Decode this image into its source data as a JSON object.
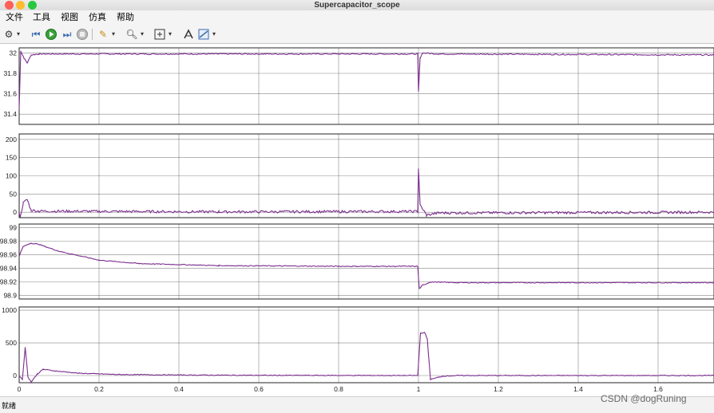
{
  "window": {
    "title": "Supercapacitor_scope"
  },
  "menu": {
    "items": [
      "文件",
      "工具",
      "视图",
      "仿真",
      "帮助"
    ]
  },
  "toolbar": {
    "icons": [
      "gear-icon",
      "rewind-icon",
      "run-icon",
      "step-forward-icon",
      "stop-icon",
      "highlight-icon",
      "zoom-icon",
      "fit-icon",
      "cursor-measure-icon",
      "signal-style-icon"
    ]
  },
  "colors": {
    "signal": "#7b2d8e",
    "grid": "#262626",
    "background": "#ffffff"
  },
  "chart_data": [
    {
      "type": "line",
      "ylim": [
        31.3,
        32.05
      ],
      "yticks": [
        "32",
        "31.8",
        "31.6",
        "31.4"
      ],
      "ytick_values": [
        32,
        31.8,
        31.6,
        31.4
      ],
      "xlim": [
        0,
        1.74
      ],
      "series": [
        {
          "values": [
            [
              0,
              31.45
            ],
            [
              0.004,
              32.02
            ],
            [
              0.012,
              31.95
            ],
            [
              0.02,
              31.9
            ],
            [
              0.03,
              31.98
            ],
            [
              0.05,
              31.99
            ],
            [
              0.5,
              31.99
            ],
            [
              0.998,
              31.99
            ],
            [
              1.0,
              31.62
            ],
            [
              1.004,
              31.95
            ],
            [
              1.01,
              32.0
            ],
            [
              1.05,
              31.99
            ],
            [
              1.74,
              31.98
            ]
          ]
        }
      ]
    },
    {
      "type": "line",
      "ylim": [
        -15,
        215
      ],
      "yticks": [
        "200",
        "150",
        "100",
        "50",
        "0"
      ],
      "ytick_values": [
        200,
        150,
        100,
        50,
        0
      ],
      "xlim": [
        0,
        1.74
      ],
      "series": [
        {
          "values": [
            [
              0,
              0
            ],
            [
              0.003,
              -12
            ],
            [
              0.01,
              25
            ],
            [
              0.02,
              35
            ],
            [
              0.03,
              5
            ],
            [
              0.05,
              3
            ],
            [
              0.5,
              1
            ],
            [
              0.998,
              2
            ],
            [
              1.0,
              120
            ],
            [
              1.004,
              20
            ],
            [
              1.02,
              -8
            ],
            [
              1.05,
              -2
            ],
            [
              1.74,
              0
            ]
          ]
        }
      ]
    },
    {
      "type": "line",
      "ylim": [
        98.895,
        99.005
      ],
      "yticks": [
        "99",
        "98.98",
        "98.96",
        "98.94",
        "98.92",
        "98.9"
      ],
      "ytick_values": [
        99,
        98.98,
        98.96,
        98.94,
        98.92,
        98.9
      ],
      "xlim": [
        0,
        1.74
      ],
      "series": [
        {
          "values": [
            [
              0,
              98.958
            ],
            [
              0.01,
              98.972
            ],
            [
              0.03,
              98.977
            ],
            [
              0.05,
              98.975
            ],
            [
              0.1,
              98.965
            ],
            [
              0.2,
              98.952
            ],
            [
              0.3,
              98.947
            ],
            [
              0.5,
              98.944
            ],
            [
              0.8,
              98.943
            ],
            [
              0.998,
              98.943
            ],
            [
              1.002,
              98.91
            ],
            [
              1.01,
              98.915
            ],
            [
              1.03,
              98.92
            ],
            [
              1.1,
              98.919
            ],
            [
              1.74,
              98.919
            ]
          ]
        }
      ]
    },
    {
      "type": "line",
      "ylim": [
        -110,
        1050
      ],
      "yticks": [
        "1000",
        "500",
        "0"
      ],
      "ytick_values": [
        1000,
        500,
        0
      ],
      "xlim": [
        0,
        1.74
      ],
      "xticks": [
        "0",
        "0.2",
        "0.4",
        "0.6",
        "0.8",
        "1",
        "1.2",
        "1.4",
        "1.6"
      ],
      "xtick_values": [
        0,
        0.2,
        0.4,
        0.6,
        0.8,
        1.0,
        1.2,
        1.4,
        1.6
      ],
      "series": [
        {
          "values": [
            [
              0,
              0
            ],
            [
              0.008,
              -60
            ],
            [
              0.015,
              430
            ],
            [
              0.022,
              -20
            ],
            [
              0.03,
              -100
            ],
            [
              0.045,
              20
            ],
            [
              0.06,
              95
            ],
            [
              0.09,
              70
            ],
            [
              0.15,
              35
            ],
            [
              0.25,
              15
            ],
            [
              0.4,
              8
            ],
            [
              0.6,
              3
            ],
            [
              0.998,
              0
            ],
            [
              1.005,
              650
            ],
            [
              1.015,
              660
            ],
            [
              1.022,
              560
            ],
            [
              1.03,
              -60
            ],
            [
              1.06,
              -10
            ],
            [
              1.1,
              0
            ],
            [
              1.74,
              0
            ]
          ]
        }
      ]
    }
  ],
  "status": {
    "text": "就绪"
  },
  "watermark": {
    "text": "CSDN @dogRuning"
  }
}
